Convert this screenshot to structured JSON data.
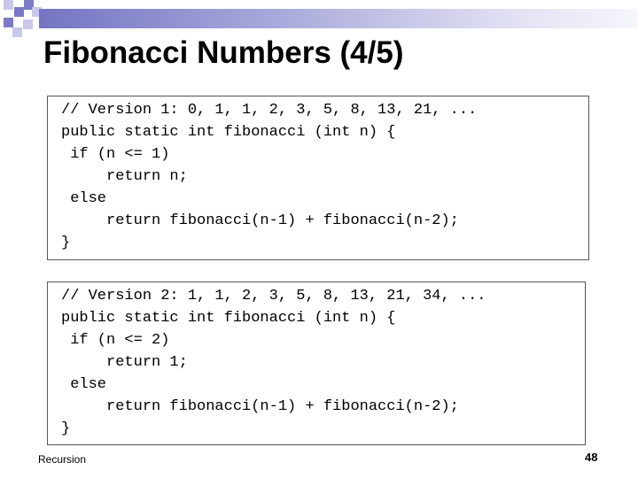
{
  "slide": {
    "title": "Fibonacci Numbers (4/5)",
    "footer": "Recursion",
    "page_number": "48"
  },
  "code_blocks": [
    {
      "lines": [
        "// Version 1: 0, 1, 1, 2, 3, 5, 8, 13, 21, ...",
        "public static int fibonacci (int n) {",
        " if (n <= 1)",
        "     return n;",
        " else",
        "     return fibonacci(n-1) + fibonacci(n-2);",
        "}"
      ]
    },
    {
      "lines": [
        "// Version 2: 1, 1, 2, 3, 5, 8, 13, 21, 34, ...",
        "public static int fibonacci (int n) {",
        " if (n <= 2)",
        "     return 1;",
        " else",
        "     return fibonacci(n-1) + fibonacci(n-2);",
        "}"
      ]
    }
  ],
  "colors": {
    "accent_dark": "#7a7ac8",
    "accent_light": "#c8c8ec"
  }
}
